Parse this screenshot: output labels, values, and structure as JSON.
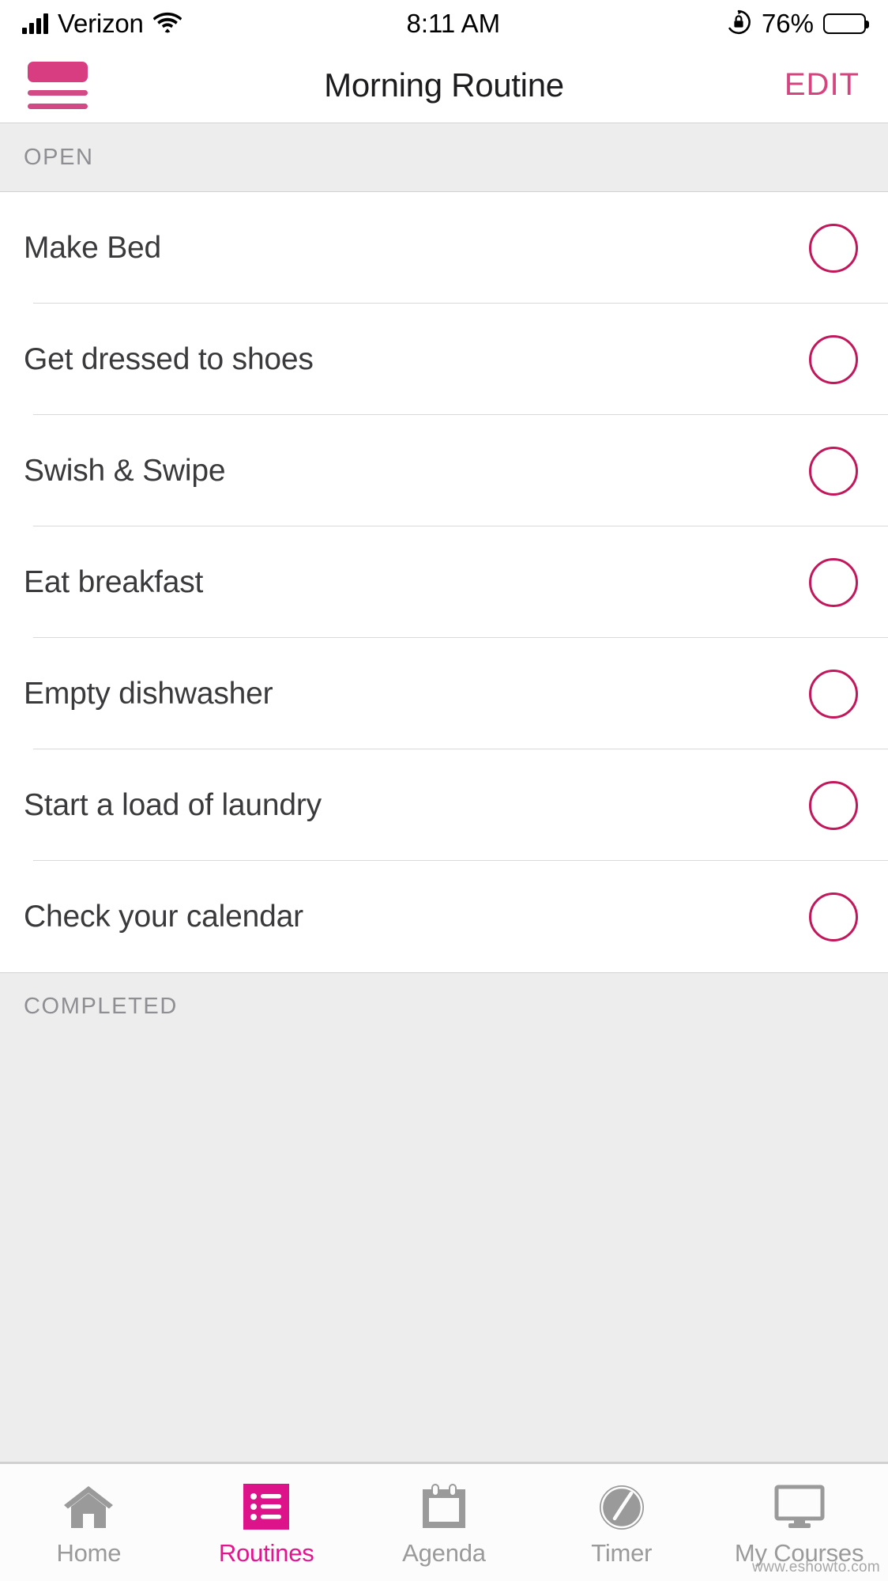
{
  "status_bar": {
    "carrier": "Verizon",
    "signal_icon": "signal-bars-icon",
    "wifi_icon": "wifi-icon",
    "time": "8:11 AM",
    "rotation_lock_icon": "rotation-lock-icon",
    "battery_percent": "76%",
    "battery_icon": "battery-icon",
    "battery_level": 76
  },
  "nav_bar": {
    "menu_icon": "list-menu-icon",
    "title": "Morning Routine",
    "edit_label": "EDIT",
    "accent_color": "#D6437F"
  },
  "sections": [
    {
      "header": "OPEN",
      "tasks": [
        {
          "label": "Make Bed",
          "completed": false
        },
        {
          "label": "Get dressed to shoes",
          "completed": false
        },
        {
          "label": "Swish & Swipe",
          "completed": false
        },
        {
          "label": "Eat breakfast",
          "completed": false
        },
        {
          "label": "Empty dishwasher",
          "completed": false
        },
        {
          "label": "Start a load of laundry",
          "completed": false
        },
        {
          "label": "Check your calendar",
          "completed": false
        }
      ]
    },
    {
      "header": "COMPLETED",
      "tasks": []
    }
  ],
  "tab_bar": {
    "active_color": "#E2158F",
    "inactive_color": "#9A9A9A",
    "tabs": [
      {
        "label": "Home",
        "icon": "home-icon",
        "active": false
      },
      {
        "label": "Routines",
        "icon": "list-icon",
        "active": true
      },
      {
        "label": "Agenda",
        "icon": "calendar-icon",
        "active": false
      },
      {
        "label": "Timer",
        "icon": "clock-icon",
        "active": false
      },
      {
        "label": "My Courses",
        "icon": "monitor-icon",
        "active": false
      }
    ]
  },
  "watermark": "www.eshowto.com",
  "colors": {
    "accent_pink": "#D6437F",
    "accent_magenta": "#E2158F",
    "checkbox_border": "#C2185B",
    "section_band": "#EDEDED",
    "text_primary": "#3a3a3c",
    "text_muted": "#8E8E93"
  }
}
